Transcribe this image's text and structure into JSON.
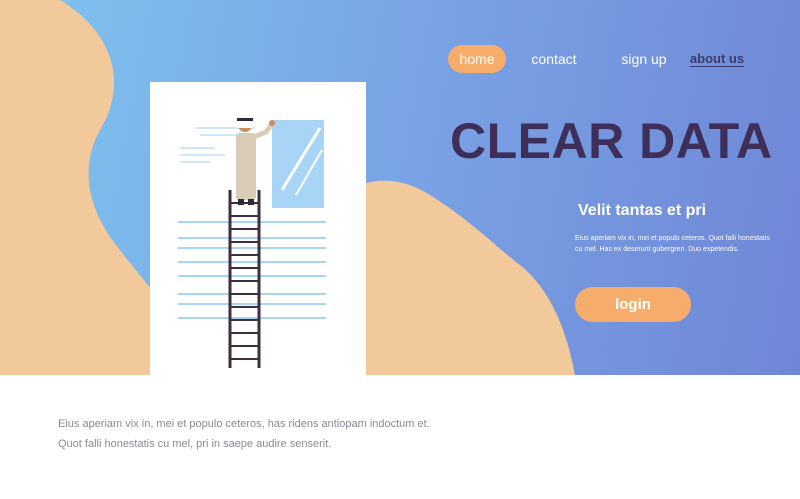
{
  "nav": {
    "home": "home",
    "contact": "contact",
    "signup": "sign up",
    "about": "about us"
  },
  "hero": {
    "title": "CLEAR DATA",
    "subtitle": "Velit tantas et pri",
    "description": "Eius aperiam vix in, mei et populo ceteros. Quot falli honestatis cu mel. Has ex deserunt gubergren. Duo expetendis.",
    "login_label": "login"
  },
  "footer": {
    "line1": "Eius aperiam vix in, mei et populo ceteros, has ridens antiopam indoctum et.",
    "line2": "Quot falli honestatis cu mel, pri in saepe audire senserit."
  },
  "colors": {
    "accent": "#f6ad6b",
    "title": "#3d2f5a",
    "blob": "#f2c99a",
    "hero_blue_start": "#7fc4ef",
    "hero_blue_end": "#6f86d6"
  }
}
